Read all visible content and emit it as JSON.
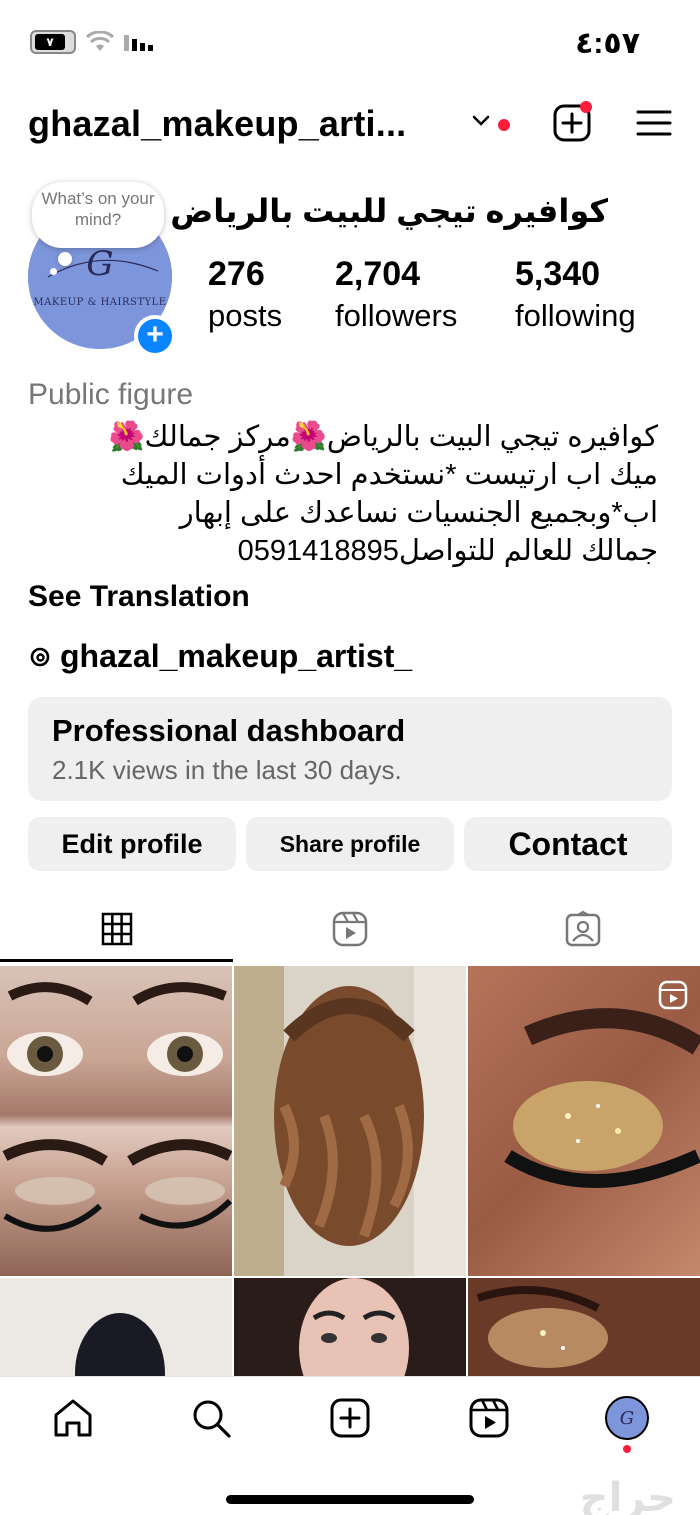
{
  "status_bar": {
    "time": "٤:٥٧",
    "battery_label": "٧"
  },
  "header": {
    "username": "ghazal_makeup_arti..."
  },
  "profile": {
    "display_name": "كوافيره تيجي للبيت بالرياض",
    "note": "What’s on your mind?",
    "avatar_text": "MAKEUP & HAIRSTYLE",
    "stats": [
      {
        "value": "276",
        "label": "posts"
      },
      {
        "value": "2,704",
        "label": "followers"
      },
      {
        "value": "5,340",
        "label": "following"
      }
    ],
    "category": "Public figure",
    "bio_lines": [
      "كوافيره تيجي البيت بالرياض🌺مركز جمالك🌺",
      "ميك اب ارتيست *نستخدم احدث أدوات الميك",
      "اب*وبجميع الجنسيات نساعدك على إبهار",
      "جمالك للعالم للتواصل0591418895"
    ],
    "see_translation": "See Translation",
    "threads_handle": "ghazal_makeup_artist_"
  },
  "dashboard": {
    "title": "Professional dashboard",
    "subtitle": "2.1K views in the last 30 days."
  },
  "buttons": {
    "edit": "Edit profile",
    "share": "Share profile",
    "contact": "Contact"
  },
  "tabs": [
    "grid-icon",
    "reels-icon",
    "tagged-icon"
  ],
  "bottom_nav": [
    "home-icon",
    "search-icon",
    "create-icon",
    "reels-icon",
    "profile-avatar"
  ],
  "watermark": "حراج",
  "colors": {
    "accent": "#0a84ff",
    "notification": "#ff1d3a",
    "surface": "#efefef"
  }
}
